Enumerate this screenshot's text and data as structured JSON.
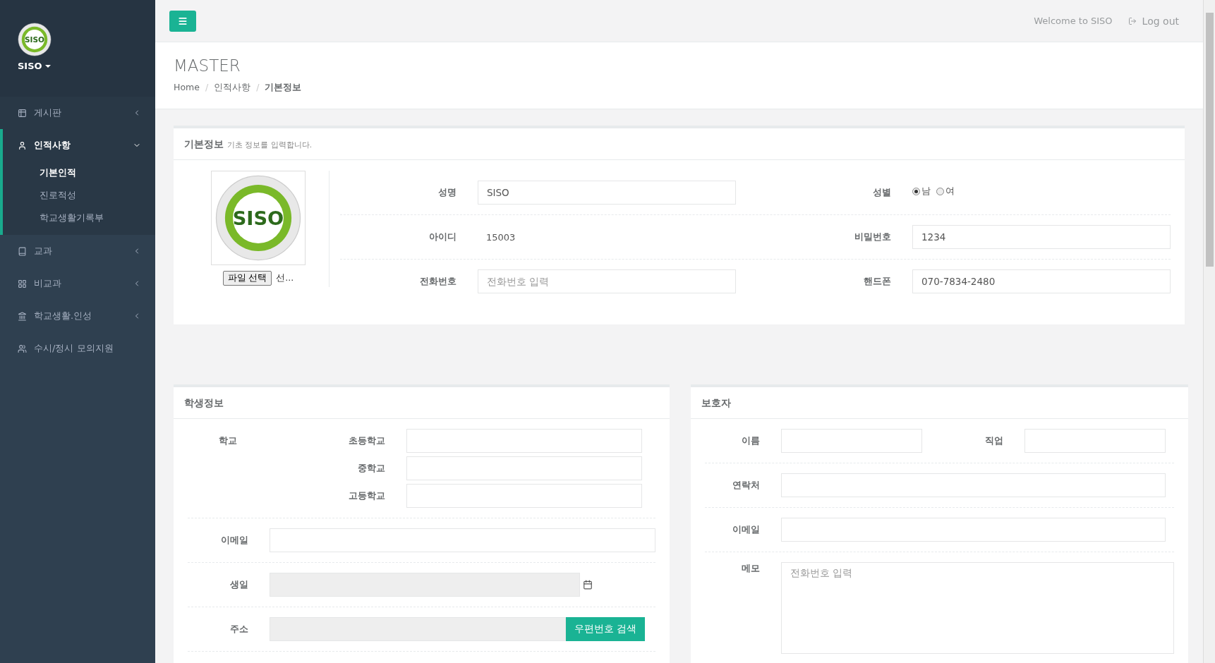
{
  "sidebar": {
    "logo_text": "SISO",
    "user": "SISO",
    "menu": [
      {
        "label": "게시판",
        "kind": "group",
        "expanded": false
      },
      {
        "label": "인적사항",
        "kind": "group",
        "expanded": true,
        "children": [
          {
            "label": "기본인적",
            "selected": true
          },
          {
            "label": "진로적성",
            "selected": false
          },
          {
            "label": "학교생활기록부",
            "selected": false
          }
        ]
      },
      {
        "label": "교과",
        "kind": "group",
        "expanded": false
      },
      {
        "label": "비교과",
        "kind": "group",
        "expanded": false
      },
      {
        "label": "학교생활.인성",
        "kind": "group",
        "expanded": false
      },
      {
        "label": "수시/정시 모의지원",
        "kind": "link",
        "expanded": false
      }
    ]
  },
  "topbar": {
    "welcome": "Welcome to SISO",
    "logout": "Log out"
  },
  "header": {
    "title": "MASTER",
    "breadcrumb": [
      "Home",
      "인적사항",
      "기본정보"
    ],
    "separator": "/"
  },
  "basic_info": {
    "title": "기본정보",
    "subtitle": "기초 정보를 입력합니다.",
    "logo_text": "SISO",
    "file_button": "파일 선택",
    "file_label": "선...",
    "rows": [
      [
        {
          "label": "성명",
          "kind": "input",
          "value": "SISO"
        },
        {
          "label": "성별",
          "kind": "radio",
          "options": [
            {
              "label": "남",
              "selected": true
            },
            {
              "label": "여",
              "selected": false
            }
          ]
        }
      ],
      [
        {
          "label": "아이디",
          "kind": "text",
          "value": "15003"
        },
        {
          "label": "비밀번호",
          "kind": "input",
          "value": "1234"
        }
      ],
      [
        {
          "label": "전화번호",
          "kind": "input",
          "placeholder": "전화번호 입력"
        },
        {
          "label": "핸드폰",
          "kind": "input",
          "value": "070-7834-2480"
        }
      ]
    ]
  },
  "student": {
    "title": "학생정보",
    "school_label": "학교",
    "schools": [
      "초등학교",
      "중학교",
      "고등학교"
    ],
    "email_label": "이메일",
    "birthday_label": "생일",
    "address_label": "주소",
    "postcode_button": "우편번호 검색"
  },
  "guardian": {
    "title": "보호자",
    "name_label": "이름",
    "job_label": "직업",
    "contact_label": "연락처",
    "email_label": "이메일",
    "memo_label": "메모",
    "memo_placeholder": "전화번호 입력"
  }
}
